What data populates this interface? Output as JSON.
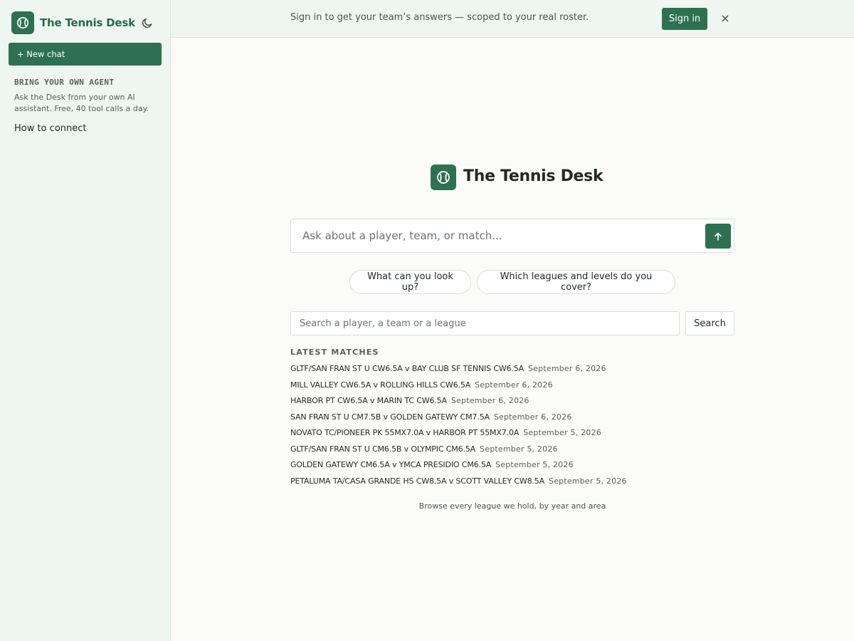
{
  "sidebar": {
    "brand": "The Tennis Desk",
    "new_chat": "+ New chat",
    "agent_title": "BRING YOUR OWN AGENT",
    "agent_desc": "Ask the Desk from your own AI assistant. Free, 40 tool calls a day.",
    "connect_link": "How to connect"
  },
  "banner": {
    "text": "Sign in to get your team’s answers — scoped to your real roster.",
    "signin": "Sign in",
    "close": "×"
  },
  "hero": {
    "title": "The Tennis Desk"
  },
  "ask": {
    "placeholder": "Ask about a player, team, or match..."
  },
  "suggestions": [
    "What can you look up?",
    "Which leagues and levels do you cover?"
  ],
  "search": {
    "placeholder": "Search a player, a team or a league",
    "button": "Search"
  },
  "latest": {
    "title": "LATEST MATCHES",
    "matches": [
      {
        "name": "GLTF/SAN FRAN ST U CW6.5A v BAY CLUB SF TENNIS CW6.5A",
        "date": "September 6, 2026"
      },
      {
        "name": "MILL VALLEY CW6.5A v ROLLING HILLS CW6.5A",
        "date": "September 6, 2026"
      },
      {
        "name": "HARBOR PT CW6.5A v MARIN TC CW6.5A",
        "date": "September 6, 2026"
      },
      {
        "name": "SAN FRAN ST U CM7.5B v GOLDEN GATEWY CM7.5A",
        "date": "September 6, 2026"
      },
      {
        "name": "NOVATO TC/PIONEER PK 55MX7.0A v HARBOR PT 55MX7.0A",
        "date": "September 5, 2026"
      },
      {
        "name": "GLTF/SAN FRAN ST U CM6.5B v OLYMPIC CM6.5A",
        "date": "September 5, 2026"
      },
      {
        "name": "GOLDEN GATEWY CM6.5A v YMCA PRESIDIO CM6.5A",
        "date": "September 5, 2026"
      },
      {
        "name": "PETALUMA TA/CASA GRANDE HS CW8.5A v SCOTT VALLEY CW8.5A",
        "date": "September 5, 2026"
      }
    ]
  },
  "browse_link": "Browse every league we hold, by year and area",
  "icons": {
    "logo": "tennis-ball-icon",
    "theme": "moon-icon",
    "send": "arrow-up-icon",
    "close": "close-icon"
  },
  "colors": {
    "accent": "#2e7150",
    "sidebar_bg": "#eff5f0",
    "page_bg": "#fbfbfa"
  }
}
